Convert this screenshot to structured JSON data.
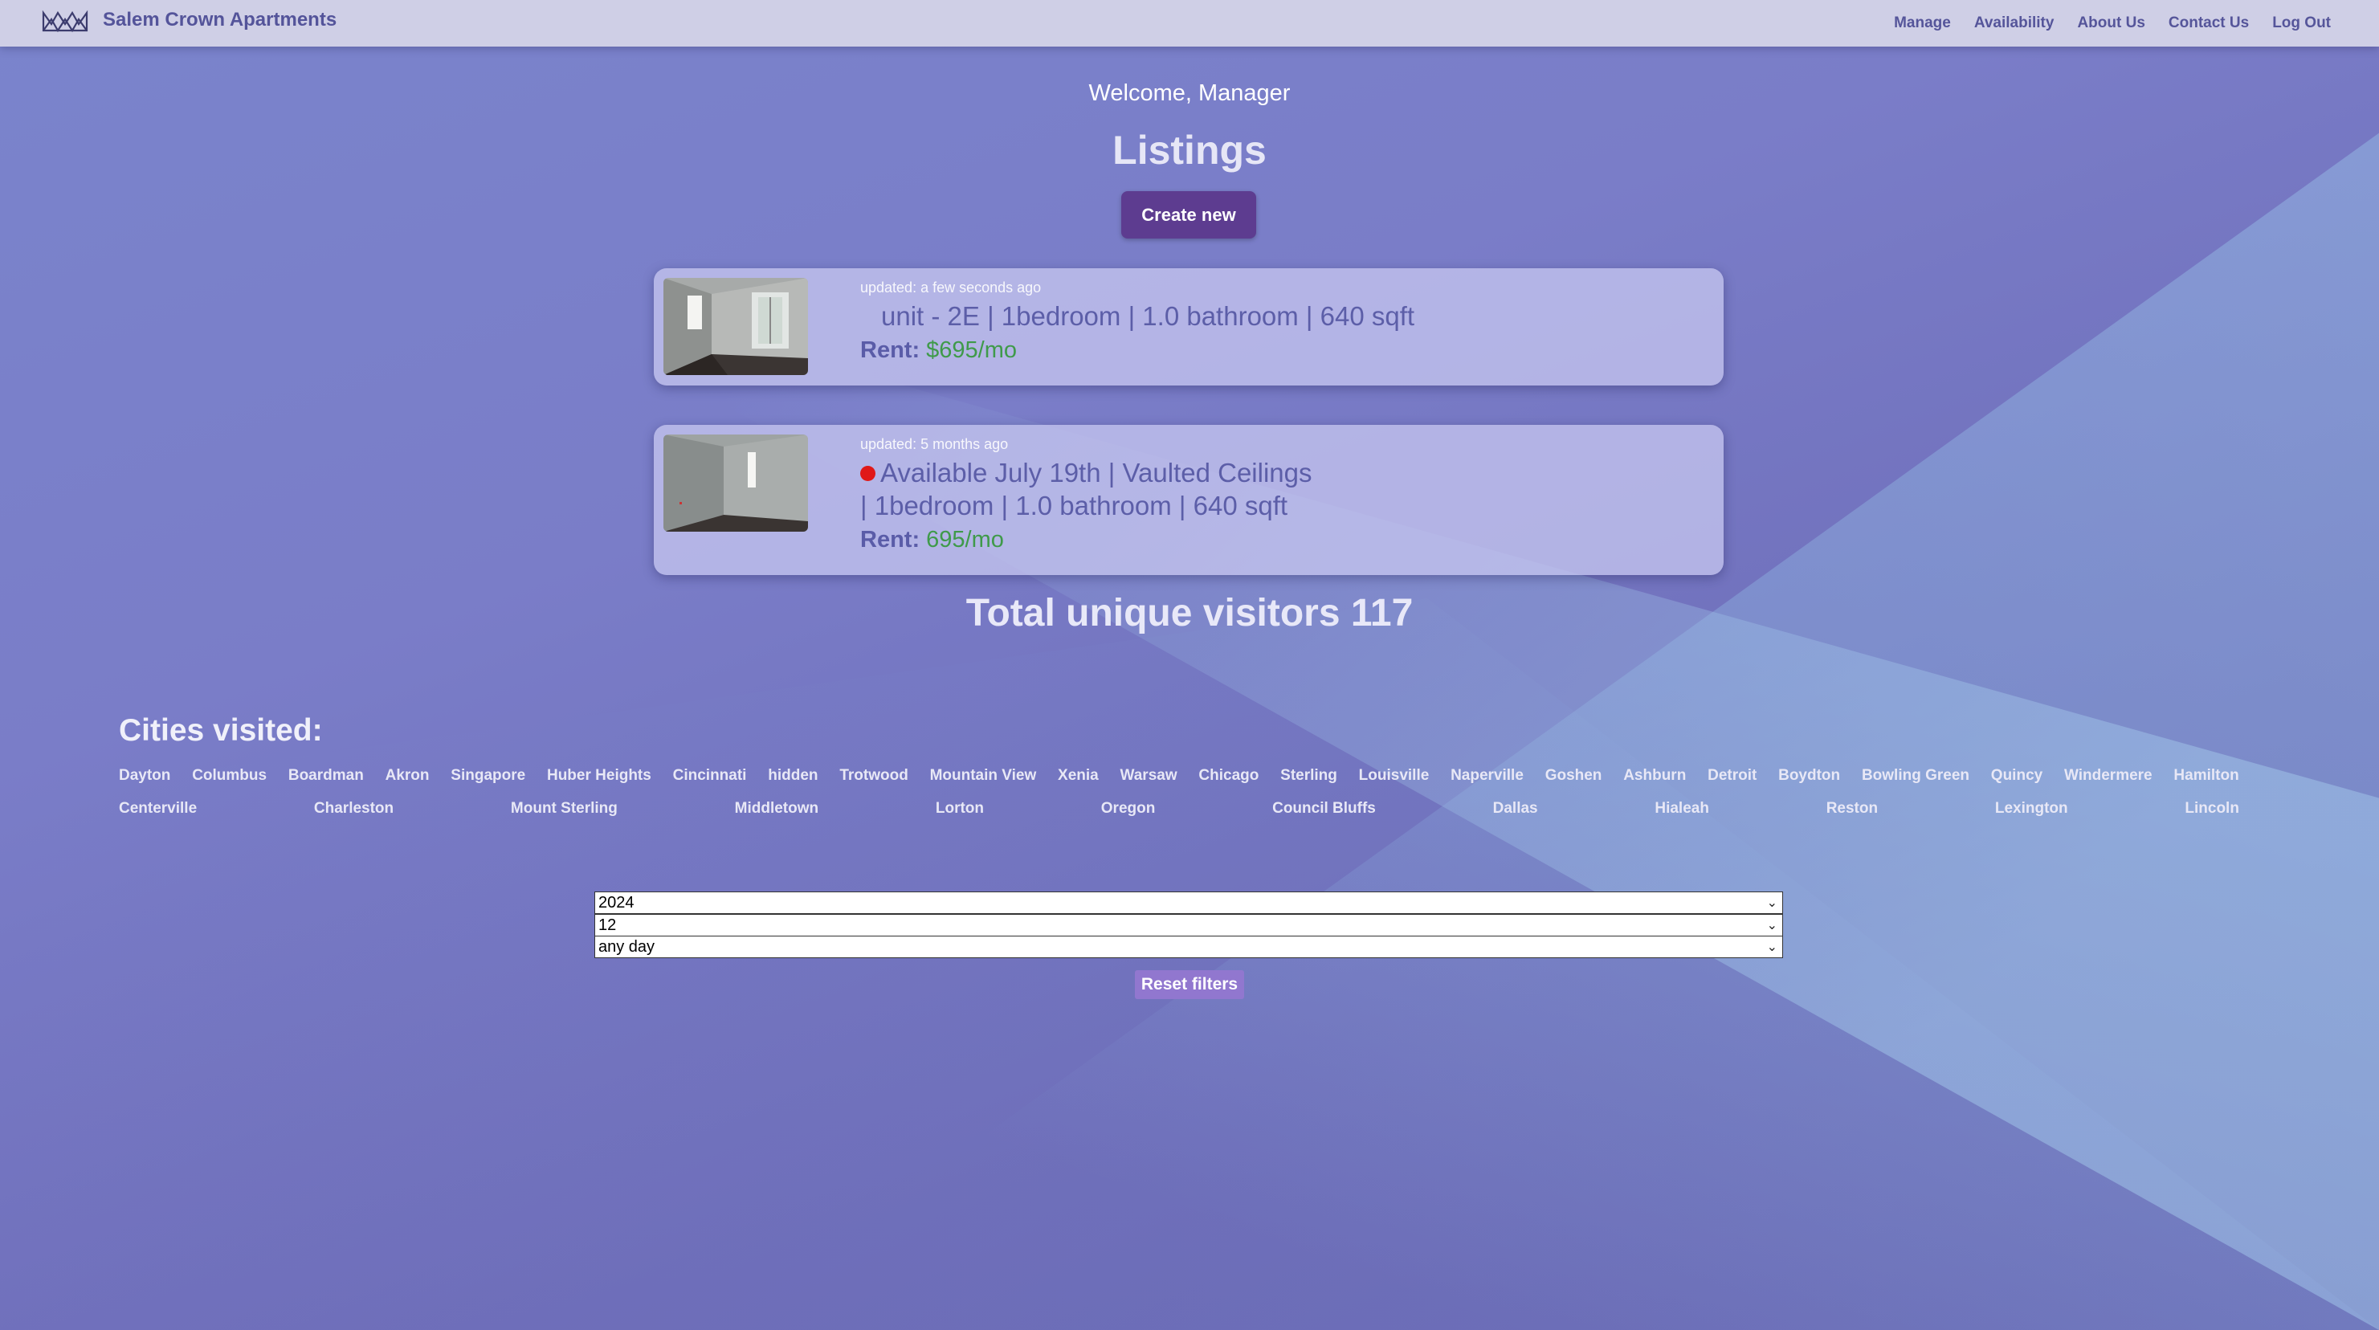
{
  "navbar": {
    "brand": "Salem Crown Apartments",
    "links": [
      "Manage",
      "Availability",
      "About Us",
      "Contact Us",
      "Log Out"
    ]
  },
  "welcome": "Welcome, Manager",
  "page_title": "Listings",
  "create_button": "Create new",
  "listings": [
    {
      "updated": "updated: a few seconds ago",
      "title_line1": "unit - 2E | 1bedroom | 1.0 bathroom | 640 sqft",
      "title_line2": "",
      "has_dot": false,
      "rent_label": "Rent:",
      "rent_value": "$695/mo"
    },
    {
      "updated": "updated: 5 months ago",
      "title_line1": "Available July 19th | Vaulted Ceilings",
      "title_line2": "| 1bedroom | 1.0 bathroom | 640 sqft",
      "has_dot": true,
      "rent_label": "Rent:",
      "rent_value": "695/mo"
    }
  ],
  "visitors": "Total unique visitors 117",
  "cities_title": "Cities visited:",
  "cities_row1": [
    "Dayton",
    "Columbus",
    "Boardman",
    "Akron",
    "Singapore",
    "Huber Heights",
    "Cincinnati",
    "hidden",
    "Trotwood",
    "Mountain View",
    "Xenia",
    "Warsaw",
    "Chicago",
    "Sterling",
    "Louisville",
    "Naperville",
    "Goshen",
    "Ashburn",
    "Detroit",
    "Boydton",
    "Bowling Green",
    "Quincy",
    "Windermere",
    "Hamilton"
  ],
  "cities_row2": [
    "Centerville",
    "Charleston",
    "Mount Sterling",
    "Middletown",
    "Lorton",
    "Oregon",
    "Council Bluffs",
    "Dallas",
    "Hialeah",
    "Reston",
    "Lexington",
    "Lincoln"
  ],
  "filters": {
    "year": "2024",
    "month": "12",
    "day": "any day",
    "reset_label": "Reset filters"
  },
  "colors": {
    "navbar_bg": "#cfcfe6",
    "brand_text": "#54549a",
    "create_button_bg": "#5d3c90",
    "rent_value": "#3f9a4a",
    "status_dot": "#e01818",
    "reset_button_bg": "#9177cf"
  }
}
